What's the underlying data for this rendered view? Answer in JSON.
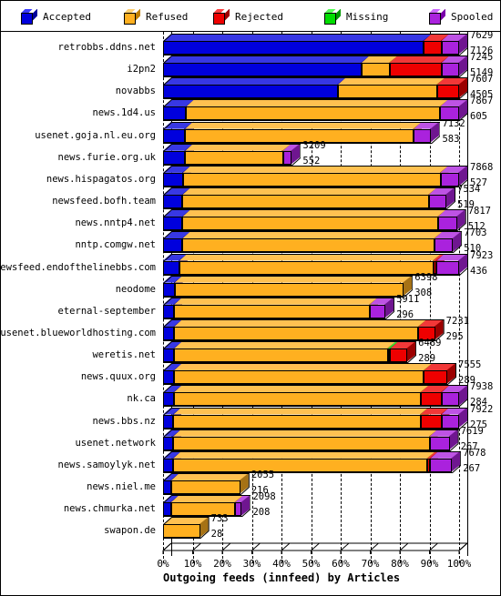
{
  "legend": {
    "items": [
      {
        "label": "Accepted",
        "color": "#0000dd",
        "top": "#3a3aff",
        "side": "#000099",
        "icon": "cube-icon"
      },
      {
        "label": "Refused",
        "color": "#ffb020",
        "top": "#ffd070",
        "side": "#c07f00",
        "icon": "cube-icon"
      },
      {
        "label": "Rejected",
        "color": "#ee0000",
        "top": "#ff4040",
        "side": "#a00000",
        "icon": "cube-icon"
      },
      {
        "label": "Missing",
        "color": "#00dd00",
        "top": "#55ff55",
        "side": "#009900",
        "icon": "cube-icon"
      },
      {
        "label": "Spooled",
        "color": "#aa22dd",
        "top": "#cc66ff",
        "side": "#7a00aa",
        "icon": "cube-icon"
      }
    ]
  },
  "axis": {
    "ticks": [
      "0%",
      "10%",
      "20%",
      "30%",
      "40%",
      "50%",
      "60%",
      "70%",
      "80%",
      "90%",
      "100%"
    ],
    "title": "Outgoing feeds (innfeed) by Articles"
  },
  "chart_data": {
    "type": "bar",
    "orientation": "horizontal",
    "stacked": true,
    "normalized": true,
    "title": "Outgoing feeds (innfeed) by Articles",
    "xlabel": "Outgoing feeds (innfeed) by Articles",
    "ylabel": "",
    "xlim": [
      0,
      100
    ],
    "xticks": [
      0,
      10,
      20,
      30,
      40,
      50,
      60,
      70,
      80,
      90,
      100
    ],
    "xtick_labels": [
      "0%",
      "10%",
      "20%",
      "30%",
      "40%",
      "50%",
      "60%",
      "70%",
      "80%",
      "90%",
      "100%"
    ],
    "grid": true,
    "legend_position": "top",
    "series": [
      "Accepted",
      "Refused",
      "Rejected",
      "Missing",
      "Spooled"
    ],
    "series_colors": [
      "#0000dd",
      "#ffb020",
      "#ee0000",
      "#00dd00",
      "#aa22dd"
    ],
    "value_labels": [
      "total_articles",
      "offered_or_secondary"
    ],
    "categories": [
      "retrobbs.ddns.net",
      "i2pn2",
      "novabbs",
      "news.1d4.us",
      "usenet.goja.nl.eu.org",
      "news.furie.org.uk",
      "news.hispagatos.org",
      "newsfeed.bofh.team",
      "news.nntp4.net",
      "nntp.comgw.net",
      "newsfeed.endofthelinebbs.com",
      "neodome",
      "eternal-september",
      "usenet.blueworldhosting.com",
      "weretis.net",
      "news.quux.org",
      "nk.ca",
      "news.bbs.nz",
      "usenet.network",
      "news.samoylyk.net",
      "news.niel.me",
      "news.chmurka.net",
      "swapon.de"
    ],
    "rows": [
      {
        "name": "retrobbs.ddns.net",
        "label_top": "7629",
        "label_bottom": "7126",
        "bar_pct": 100,
        "segments": [
          {
            "series": "Accepted",
            "pct": 88.0
          },
          {
            "series": "Rejected",
            "pct": 6.0
          },
          {
            "series": "Spooled",
            "pct": 6.0
          }
        ]
      },
      {
        "name": "i2pn2",
        "label_top": "7245",
        "label_bottom": "5149",
        "bar_pct": 100,
        "segments": [
          {
            "series": "Accepted",
            "pct": 67.0
          },
          {
            "series": "Refused",
            "pct": 9.5
          },
          {
            "series": "Rejected",
            "pct": 17.5
          },
          {
            "series": "Spooled",
            "pct": 6.0
          }
        ]
      },
      {
        "name": "novabbs",
        "label_top": "7607",
        "label_bottom": "4505",
        "bar_pct": 100,
        "segments": [
          {
            "series": "Accepted",
            "pct": 59.0
          },
          {
            "series": "Refused",
            "pct": 33.5
          },
          {
            "series": "Rejected",
            "pct": 7.5
          }
        ]
      },
      {
        "name": "news.1d4.us",
        "label_top": "7867",
        "label_bottom": "605",
        "bar_pct": 100,
        "segments": [
          {
            "series": "Accepted",
            "pct": 7.7
          },
          {
            "series": "Refused",
            "pct": 85.8
          },
          {
            "series": "Spooled",
            "pct": 6.5
          }
        ]
      },
      {
        "name": "usenet.goja.nl.eu.org",
        "label_top": "7132",
        "label_bottom": "583",
        "bar_pct": 90.6,
        "segments": [
          {
            "series": "Accepted",
            "pct": 8.2
          },
          {
            "series": "Refused",
            "pct": 85.3
          },
          {
            "series": "Spooled",
            "pct": 6.5
          }
        ]
      },
      {
        "name": "news.furie.org.uk",
        "label_top": "3209",
        "label_bottom": "552",
        "bar_pct": 43.5,
        "segments": [
          {
            "series": "Accepted",
            "pct": 17.2
          },
          {
            "series": "Refused",
            "pct": 76.0
          },
          {
            "series": "Spooled",
            "pct": 6.8
          }
        ]
      },
      {
        "name": "news.hispagatos.org",
        "label_top": "7868",
        "label_bottom": "527",
        "bar_pct": 100,
        "segments": [
          {
            "series": "Accepted",
            "pct": 6.7
          },
          {
            "series": "Refused",
            "pct": 87.0
          },
          {
            "series": "Spooled",
            "pct": 6.3
          }
        ]
      },
      {
        "name": "newsfeed.bofh.team",
        "label_top": "7534",
        "label_bottom": "519",
        "bar_pct": 95.7,
        "segments": [
          {
            "series": "Accepted",
            "pct": 6.9
          },
          {
            "series": "Refused",
            "pct": 86.9
          },
          {
            "series": "Spooled",
            "pct": 6.2
          }
        ]
      },
      {
        "name": "news.nntp4.net",
        "label_top": "7817",
        "label_bottom": "512",
        "bar_pct": 99.3,
        "segments": [
          {
            "series": "Accepted",
            "pct": 6.6
          },
          {
            "series": "Refused",
            "pct": 86.9
          },
          {
            "series": "Spooled",
            "pct": 6.5
          }
        ]
      },
      {
        "name": "nntp.comgw.net",
        "label_top": "7703",
        "label_bottom": "510",
        "bar_pct": 97.9,
        "segments": [
          {
            "series": "Accepted",
            "pct": 6.6
          },
          {
            "series": "Refused",
            "pct": 87.0
          },
          {
            "series": "Spooled",
            "pct": 6.4
          }
        ]
      },
      {
        "name": "newsfeed.endofthelinebbs.com",
        "label_top": "7923",
        "label_bottom": "436",
        "bar_pct": 100,
        "segments": [
          {
            "series": "Accepted",
            "pct": 5.5
          },
          {
            "series": "Refused",
            "pct": 85.8
          },
          {
            "series": "Rejected",
            "pct": 1.1
          },
          {
            "series": "Spooled",
            "pct": 7.6
          }
        ]
      },
      {
        "name": "neodome",
        "label_top": "6398",
        "label_bottom": "308",
        "bar_pct": 81.3,
        "segments": [
          {
            "series": "Accepted",
            "pct": 4.8
          },
          {
            "series": "Refused",
            "pct": 95.2
          }
        ]
      },
      {
        "name": "eternal-september",
        "label_top": "5911",
        "label_bottom": "296",
        "bar_pct": 75.1,
        "segments": [
          {
            "series": "Accepted",
            "pct": 5.0
          },
          {
            "series": "Refused",
            "pct": 88.0
          },
          {
            "series": "Spooled",
            "pct": 7.0
          }
        ]
      },
      {
        "name": "usenet.blueworldhosting.com",
        "label_top": "7231",
        "label_bottom": "295",
        "bar_pct": 91.9,
        "segments": [
          {
            "series": "Accepted",
            "pct": 4.1
          },
          {
            "series": "Refused",
            "pct": 89.8
          },
          {
            "series": "Rejected",
            "pct": 6.1
          }
        ]
      },
      {
        "name": "weretis.net",
        "label_top": "6489",
        "label_bottom": "289",
        "bar_pct": 82.5,
        "segments": [
          {
            "series": "Accepted",
            "pct": 4.5
          },
          {
            "series": "Refused",
            "pct": 87.5
          },
          {
            "series": "Missing",
            "pct": 1.0
          },
          {
            "series": "Rejected",
            "pct": 7.0
          }
        ]
      },
      {
        "name": "news.quux.org",
        "label_top": "7555",
        "label_bottom": "289",
        "bar_pct": 96.0,
        "segments": [
          {
            "series": "Accepted",
            "pct": 3.8
          },
          {
            "series": "Refused",
            "pct": 88.0
          },
          {
            "series": "Rejected",
            "pct": 8.2
          }
        ]
      },
      {
        "name": "nk.ca",
        "label_top": "7938",
        "label_bottom": "284",
        "bar_pct": 100,
        "segments": [
          {
            "series": "Accepted",
            "pct": 3.6
          },
          {
            "series": "Refused",
            "pct": 83.4
          },
          {
            "series": "Rejected",
            "pct": 7.0
          },
          {
            "series": "Spooled",
            "pct": 6.0
          }
        ]
      },
      {
        "name": "news.bbs.nz",
        "label_top": "7922",
        "label_bottom": "275",
        "bar_pct": 100,
        "segments": [
          {
            "series": "Accepted",
            "pct": 3.5
          },
          {
            "series": "Refused",
            "pct": 83.5
          },
          {
            "series": "Rejected",
            "pct": 7.0
          },
          {
            "series": "Spooled",
            "pct": 6.0
          }
        ]
      },
      {
        "name": "usenet.network",
        "label_top": "7619",
        "label_bottom": "267",
        "bar_pct": 96.8,
        "segments": [
          {
            "series": "Accepted",
            "pct": 3.5
          },
          {
            "series": "Refused",
            "pct": 89.5
          },
          {
            "series": "Spooled",
            "pct": 7.0
          }
        ]
      },
      {
        "name": "news.samoylyk.net",
        "label_top": "7678",
        "label_bottom": "267",
        "bar_pct": 97.6,
        "segments": [
          {
            "series": "Accepted",
            "pct": 3.5
          },
          {
            "series": "Refused",
            "pct": 88.0
          },
          {
            "series": "Rejected",
            "pct": 1.0
          },
          {
            "series": "Spooled",
            "pct": 7.5
          }
        ]
      },
      {
        "name": "news.niel.me",
        "label_top": "2055",
        "label_bottom": "216",
        "bar_pct": 26.1,
        "segments": [
          {
            "series": "Accepted",
            "pct": 10.5
          },
          {
            "series": "Refused",
            "pct": 89.5
          }
        ]
      },
      {
        "name": "news.chmurka.net",
        "label_top": "2098",
        "label_bottom": "208",
        "bar_pct": 26.6,
        "segments": [
          {
            "series": "Accepted",
            "pct": 10.0
          },
          {
            "series": "Refused",
            "pct": 81.5
          },
          {
            "series": "Spooled",
            "pct": 8.5
          }
        ]
      },
      {
        "name": "swapon.de",
        "label_top": "733",
        "label_bottom": "28",
        "bar_pct": 12.5,
        "segments": [
          {
            "series": "Refused",
            "pct": 100
          }
        ]
      }
    ]
  }
}
